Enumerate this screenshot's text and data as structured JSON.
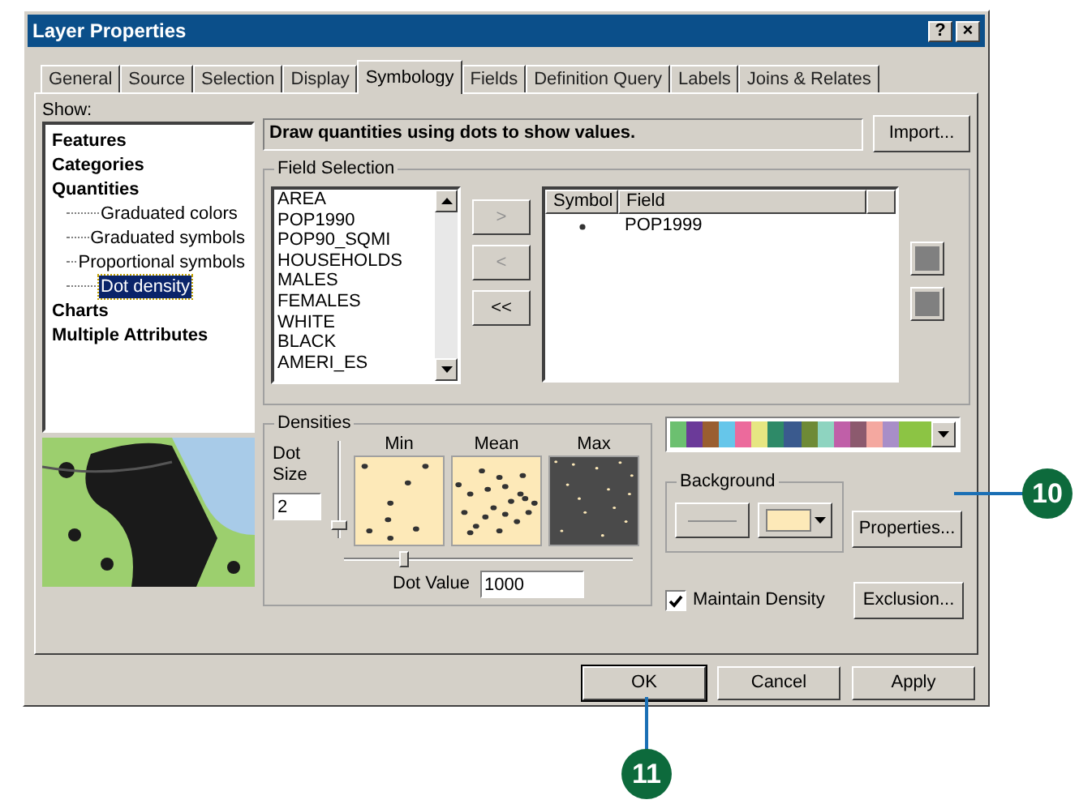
{
  "window": {
    "title": "Layer Properties",
    "controls": [
      "?",
      "×"
    ]
  },
  "tabs": [
    {
      "label": "General",
      "selected": false
    },
    {
      "label": "Source",
      "selected": false
    },
    {
      "label": "Selection",
      "selected": false
    },
    {
      "label": "Display",
      "selected": false
    },
    {
      "label": "Symbology",
      "selected": true
    },
    {
      "label": "Fields",
      "selected": false
    },
    {
      "label": "Definition Query",
      "selected": false
    },
    {
      "label": "Labels",
      "selected": false
    },
    {
      "label": "Joins & Relates",
      "selected": false
    }
  ],
  "show": {
    "label": "Show:",
    "tree": [
      {
        "label": "Features",
        "selected": false
      },
      {
        "label": "Categories",
        "selected": false
      },
      {
        "label": "Quantities",
        "selected": false,
        "children": [
          {
            "label": "Graduated colors",
            "selected": false
          },
          {
            "label": "Graduated symbols",
            "selected": false
          },
          {
            "label": "Proportional symbols",
            "selected": false
          },
          {
            "label": "Dot density",
            "selected": true
          }
        ]
      },
      {
        "label": "Charts",
        "selected": false
      },
      {
        "label": "Multiple Attributes",
        "selected": false
      }
    ]
  },
  "description": "Draw quantities using dots to show values.",
  "import_button": "Import...",
  "field_selection": {
    "title": "Field Selection",
    "fields": [
      "AREA",
      "POP1990",
      "POP90_SQMI",
      "HOUSEHOLDS",
      "MALES",
      "FEMALES",
      "WHITE",
      "BLACK",
      "AMERI_ES"
    ],
    "move_buttons": [
      ">",
      "<",
      "<<"
    ],
    "columns": [
      "Symbol",
      "Field"
    ],
    "rows": [
      {
        "field": "POP1999"
      }
    ]
  },
  "densities": {
    "title": "Densities",
    "dot_size_label": "Dot Size",
    "dot_size": "2",
    "dot_size_slider": {
      "level": 0.1
    },
    "previews": [
      {
        "label": "Min",
        "kind": "sparse"
      },
      {
        "label": "Mean",
        "kind": "dense"
      },
      {
        "label": "Max",
        "kind": "full"
      }
    ],
    "dot_value_slider": {
      "level": 0.2
    },
    "dot_value_label": "Dot Value",
    "dot_value": "1000"
  },
  "color_ramp": [
    {
      "color": "#6cc070"
    },
    {
      "color": "#6b3a99"
    },
    {
      "color": "#9a5e30"
    },
    {
      "color": "#66c6ea"
    },
    {
      "color": "#ec6a9c"
    },
    {
      "color": "#e6e682"
    },
    {
      "color": "#2e8a68"
    },
    {
      "color": "#3a5a8e"
    },
    {
      "color": "#6e8a36"
    },
    {
      "color": "#8ed4c0"
    },
    {
      "color": "#c05fa8"
    },
    {
      "color": "#8c5a6e"
    },
    {
      "color": "#f4a8a0"
    },
    {
      "color": "#a88ec8"
    },
    {
      "color": "#8cc444"
    }
  ],
  "background": {
    "title": "Background",
    "color": "#fde9b8"
  },
  "properties_button": "Properties...",
  "maintain_density": {
    "label": "Maintain Density",
    "checked": true
  },
  "exclusion_button": "Exclusion...",
  "dialog_buttons": [
    "OK",
    "Cancel",
    "Apply"
  ],
  "callouts": [
    "10",
    "11"
  ]
}
